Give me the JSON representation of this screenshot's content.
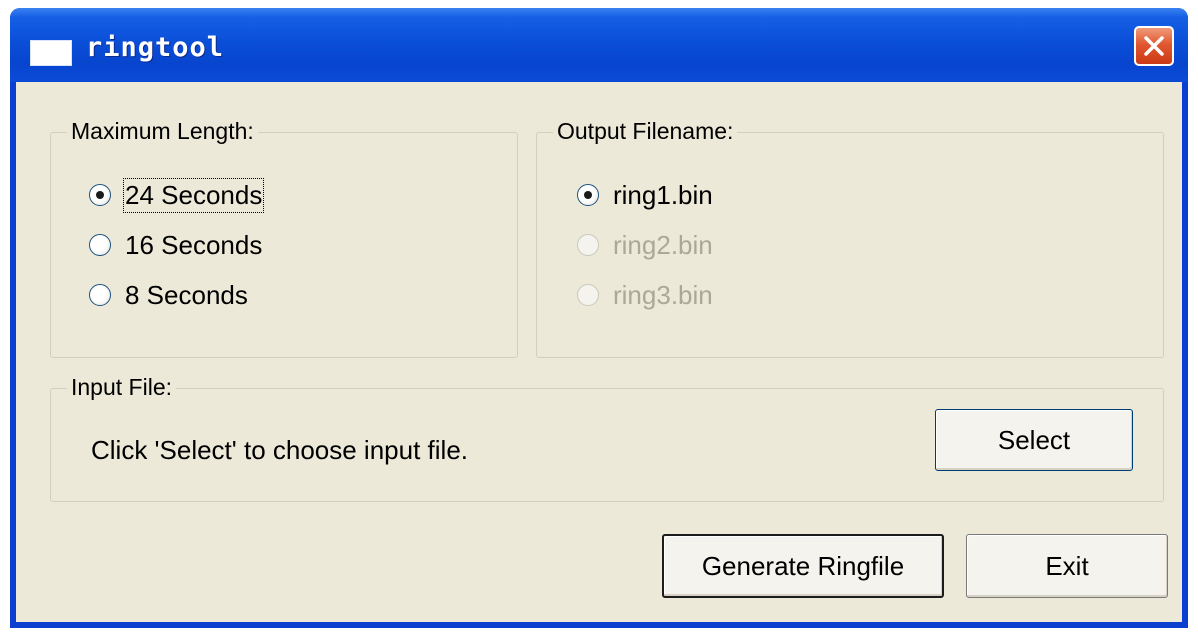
{
  "window": {
    "title": "ringtool"
  },
  "max_length": {
    "legend": "Maximum Length:",
    "options": [
      {
        "label": "24 Seconds",
        "checked": true,
        "disabled": false
      },
      {
        "label": "16 Seconds",
        "checked": false,
        "disabled": false
      },
      {
        "label": "8 Seconds",
        "checked": false,
        "disabled": false
      }
    ]
  },
  "output_filename": {
    "legend": "Output Filename:",
    "options": [
      {
        "label": "ring1.bin",
        "checked": true,
        "disabled": false
      },
      {
        "label": "ring2.bin",
        "checked": false,
        "disabled": true
      },
      {
        "label": "ring3.bin",
        "checked": false,
        "disabled": true
      }
    ]
  },
  "input_file": {
    "legend": "Input File:",
    "message": "Click 'Select' to choose input file.",
    "select_label": "Select"
  },
  "footer": {
    "generate_label": "Generate Ringfile",
    "exit_label": "Exit"
  }
}
